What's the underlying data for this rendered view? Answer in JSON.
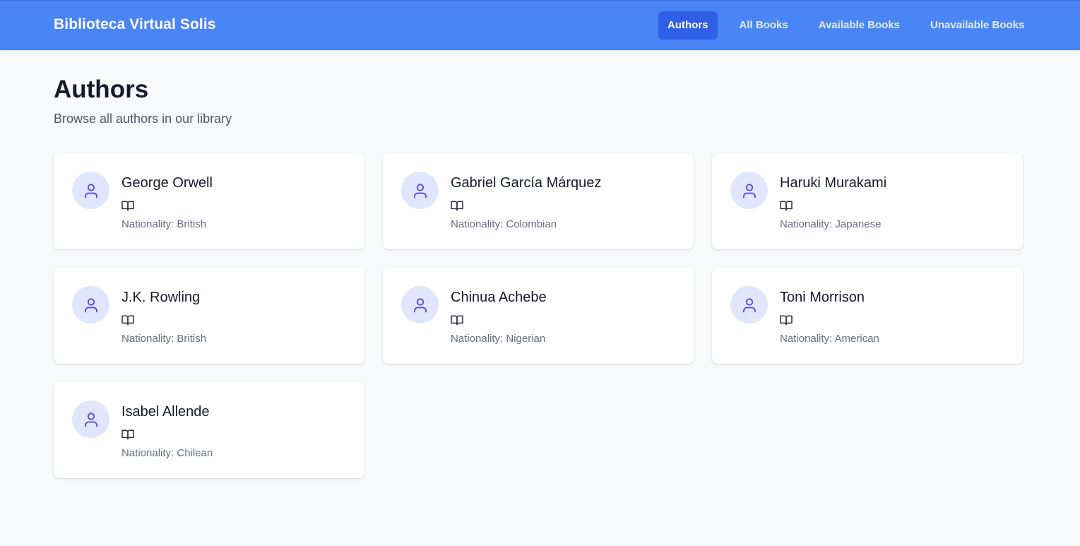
{
  "app": {
    "brand": "Biblioteca Virtual Solis"
  },
  "nav": {
    "items": [
      {
        "label": "Authors",
        "active": true
      },
      {
        "label": "All Books",
        "active": false
      },
      {
        "label": "Available Books",
        "active": false
      },
      {
        "label": "Unavailable Books",
        "active": false
      }
    ]
  },
  "page": {
    "title": "Authors",
    "subtitle": "Browse all authors in our library"
  },
  "authors": [
    {
      "name": "George Orwell",
      "nationality": "Nationality: British"
    },
    {
      "name": "Gabriel García Márquez",
      "nationality": "Nationality: Colombian"
    },
    {
      "name": "Haruki Murakami",
      "nationality": "Nationality: Japanese"
    },
    {
      "name": "J.K. Rowling",
      "nationality": "Nationality: British"
    },
    {
      "name": "Chinua Achebe",
      "nationality": "Nationality: Nigerian"
    },
    {
      "name": "Toni Morrison",
      "nationality": "Nationality: American"
    },
    {
      "name": "Isabel Allende",
      "nationality": "Nationality: Chilean"
    }
  ],
  "icons": {
    "avatar": "user-icon",
    "books": "book-open-icon"
  },
  "colors": {
    "header": "#4a85f6",
    "active_nav": "#2f5fe6",
    "avatar_bg": "#e2e6fd",
    "avatar_icon": "#4f46e5"
  }
}
